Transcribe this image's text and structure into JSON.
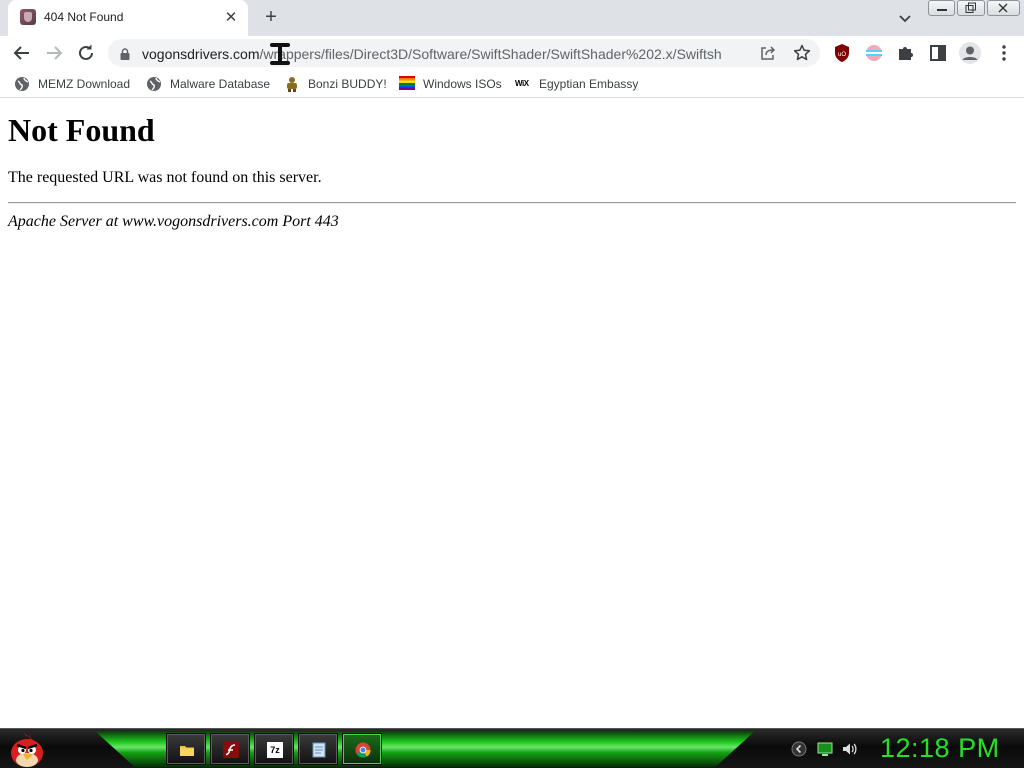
{
  "browser": {
    "tab": {
      "title": "404 Not Found",
      "close_glyph": "✕",
      "favicon": "page-favicon"
    },
    "new_tab_glyph": "+",
    "omnibox": {
      "host": "vogonsdrivers.com",
      "path": "/wrappers/files/Direct3D/Software/SwiftShader/SwiftShader%202.x/Swiftsh"
    },
    "toolbar_icons": [
      "back-icon",
      "forward-icon",
      "reload-icon",
      "lock-icon",
      "share-icon",
      "star-icon",
      "ublock-icon",
      "flag-extension-icon",
      "puzzle-icon",
      "side-panel-icon",
      "profile-icon",
      "menu-icon"
    ],
    "bookmarks": [
      {
        "label": "MEMZ Download",
        "icon": "globe-icon"
      },
      {
        "label": "Malware Database",
        "icon": "globe-icon"
      },
      {
        "label": "Bonzi BUDDY!",
        "icon": "bonzi-icon"
      },
      {
        "label": "Windows ISOs",
        "icon": "rainbow-flag-icon"
      },
      {
        "label": "Egyptian Embassy",
        "icon": "wix-icon"
      }
    ],
    "wix_text": "WiX"
  },
  "page": {
    "heading": "Not Found",
    "message": "The requested URL was not found on this server.",
    "address": "Apache Server at www.vogonsdrivers.com Port 443"
  },
  "taskbar": {
    "start_icon": "angry-bird-icon",
    "pinned": [
      {
        "icon": "folder-icon",
        "active": false
      },
      {
        "icon": "flash-icon",
        "active": false
      },
      {
        "icon": "7zip-icon",
        "label": "7z",
        "active": false
      },
      {
        "icon": "notepad-icon",
        "active": false
      },
      {
        "icon": "chrome-icon",
        "active": true
      }
    ],
    "tray_icons": [
      "chevron-icon",
      "network-icon",
      "volume-icon"
    ],
    "clock": "12:18 PM"
  },
  "colors": {
    "tab_strip": "#dee1e6",
    "clock_green": "#25e025",
    "taskbar_green": "#1ed11e"
  }
}
